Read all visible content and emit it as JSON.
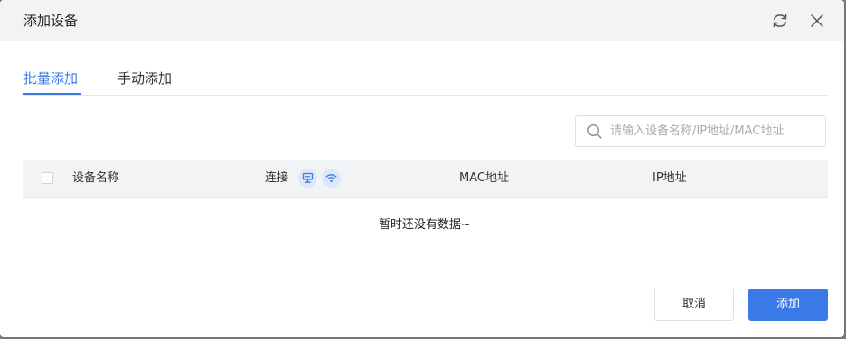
{
  "dialog": {
    "title": "添加设备",
    "refresh_icon": "refresh-icon",
    "close_icon": "close-icon"
  },
  "tabs": [
    {
      "label": "批量添加",
      "active": true
    },
    {
      "label": "手动添加",
      "active": false
    }
  ],
  "search": {
    "placeholder": "请输入设备名称/IP地址/MAC地址",
    "value": ""
  },
  "table": {
    "columns": {
      "name": "设备名称",
      "connection": "连接",
      "mac": "MAC地址",
      "ip": "IP地址"
    },
    "connection_icons": [
      "wired-icon",
      "wifi-icon"
    ],
    "rows": [],
    "empty_text": "暂时还没有数据~"
  },
  "footer": {
    "cancel_label": "取消",
    "add_label": "添加"
  },
  "colors": {
    "accent": "#3a7ae8",
    "header_bg": "#f3f3f3",
    "table_head_bg": "#f2f3f5"
  }
}
